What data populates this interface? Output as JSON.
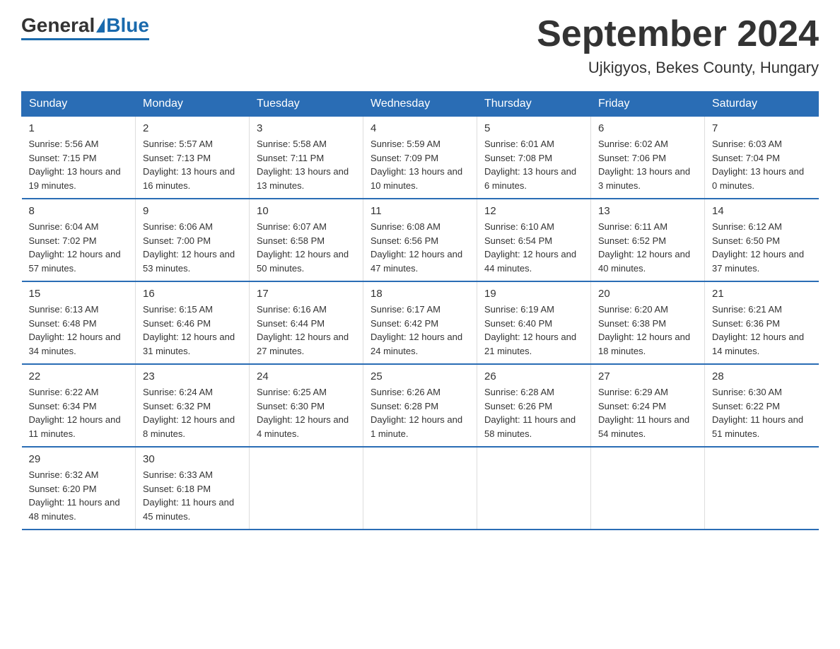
{
  "logo": {
    "general": "General",
    "blue": "Blue"
  },
  "title": "September 2024",
  "subtitle": "Ujkigyos, Bekes County, Hungary",
  "days_of_week": [
    "Sunday",
    "Monday",
    "Tuesday",
    "Wednesday",
    "Thursday",
    "Friday",
    "Saturday"
  ],
  "weeks": [
    [
      {
        "day": "1",
        "sunrise": "5:56 AM",
        "sunset": "7:15 PM",
        "daylight": "13 hours and 19 minutes."
      },
      {
        "day": "2",
        "sunrise": "5:57 AM",
        "sunset": "7:13 PM",
        "daylight": "13 hours and 16 minutes."
      },
      {
        "day": "3",
        "sunrise": "5:58 AM",
        "sunset": "7:11 PM",
        "daylight": "13 hours and 13 minutes."
      },
      {
        "day": "4",
        "sunrise": "5:59 AM",
        "sunset": "7:09 PM",
        "daylight": "13 hours and 10 minutes."
      },
      {
        "day": "5",
        "sunrise": "6:01 AM",
        "sunset": "7:08 PM",
        "daylight": "13 hours and 6 minutes."
      },
      {
        "day": "6",
        "sunrise": "6:02 AM",
        "sunset": "7:06 PM",
        "daylight": "13 hours and 3 minutes."
      },
      {
        "day": "7",
        "sunrise": "6:03 AM",
        "sunset": "7:04 PM",
        "daylight": "13 hours and 0 minutes."
      }
    ],
    [
      {
        "day": "8",
        "sunrise": "6:04 AM",
        "sunset": "7:02 PM",
        "daylight": "12 hours and 57 minutes."
      },
      {
        "day": "9",
        "sunrise": "6:06 AM",
        "sunset": "7:00 PM",
        "daylight": "12 hours and 53 minutes."
      },
      {
        "day": "10",
        "sunrise": "6:07 AM",
        "sunset": "6:58 PM",
        "daylight": "12 hours and 50 minutes."
      },
      {
        "day": "11",
        "sunrise": "6:08 AM",
        "sunset": "6:56 PM",
        "daylight": "12 hours and 47 minutes."
      },
      {
        "day": "12",
        "sunrise": "6:10 AM",
        "sunset": "6:54 PM",
        "daylight": "12 hours and 44 minutes."
      },
      {
        "day": "13",
        "sunrise": "6:11 AM",
        "sunset": "6:52 PM",
        "daylight": "12 hours and 40 minutes."
      },
      {
        "day": "14",
        "sunrise": "6:12 AM",
        "sunset": "6:50 PM",
        "daylight": "12 hours and 37 minutes."
      }
    ],
    [
      {
        "day": "15",
        "sunrise": "6:13 AM",
        "sunset": "6:48 PM",
        "daylight": "12 hours and 34 minutes."
      },
      {
        "day": "16",
        "sunrise": "6:15 AM",
        "sunset": "6:46 PM",
        "daylight": "12 hours and 31 minutes."
      },
      {
        "day": "17",
        "sunrise": "6:16 AM",
        "sunset": "6:44 PM",
        "daylight": "12 hours and 27 minutes."
      },
      {
        "day": "18",
        "sunrise": "6:17 AM",
        "sunset": "6:42 PM",
        "daylight": "12 hours and 24 minutes."
      },
      {
        "day": "19",
        "sunrise": "6:19 AM",
        "sunset": "6:40 PM",
        "daylight": "12 hours and 21 minutes."
      },
      {
        "day": "20",
        "sunrise": "6:20 AM",
        "sunset": "6:38 PM",
        "daylight": "12 hours and 18 minutes."
      },
      {
        "day": "21",
        "sunrise": "6:21 AM",
        "sunset": "6:36 PM",
        "daylight": "12 hours and 14 minutes."
      }
    ],
    [
      {
        "day": "22",
        "sunrise": "6:22 AM",
        "sunset": "6:34 PM",
        "daylight": "12 hours and 11 minutes."
      },
      {
        "day": "23",
        "sunrise": "6:24 AM",
        "sunset": "6:32 PM",
        "daylight": "12 hours and 8 minutes."
      },
      {
        "day": "24",
        "sunrise": "6:25 AM",
        "sunset": "6:30 PM",
        "daylight": "12 hours and 4 minutes."
      },
      {
        "day": "25",
        "sunrise": "6:26 AM",
        "sunset": "6:28 PM",
        "daylight": "12 hours and 1 minute."
      },
      {
        "day": "26",
        "sunrise": "6:28 AM",
        "sunset": "6:26 PM",
        "daylight": "11 hours and 58 minutes."
      },
      {
        "day": "27",
        "sunrise": "6:29 AM",
        "sunset": "6:24 PM",
        "daylight": "11 hours and 54 minutes."
      },
      {
        "day": "28",
        "sunrise": "6:30 AM",
        "sunset": "6:22 PM",
        "daylight": "11 hours and 51 minutes."
      }
    ],
    [
      {
        "day": "29",
        "sunrise": "6:32 AM",
        "sunset": "6:20 PM",
        "daylight": "11 hours and 48 minutes."
      },
      {
        "day": "30",
        "sunrise": "6:33 AM",
        "sunset": "6:18 PM",
        "daylight": "11 hours and 45 minutes."
      },
      {
        "day": "",
        "sunrise": "",
        "sunset": "",
        "daylight": ""
      },
      {
        "day": "",
        "sunrise": "",
        "sunset": "",
        "daylight": ""
      },
      {
        "day": "",
        "sunrise": "",
        "sunset": "",
        "daylight": ""
      },
      {
        "day": "",
        "sunrise": "",
        "sunset": "",
        "daylight": ""
      },
      {
        "day": "",
        "sunrise": "",
        "sunset": "",
        "daylight": ""
      }
    ]
  ]
}
